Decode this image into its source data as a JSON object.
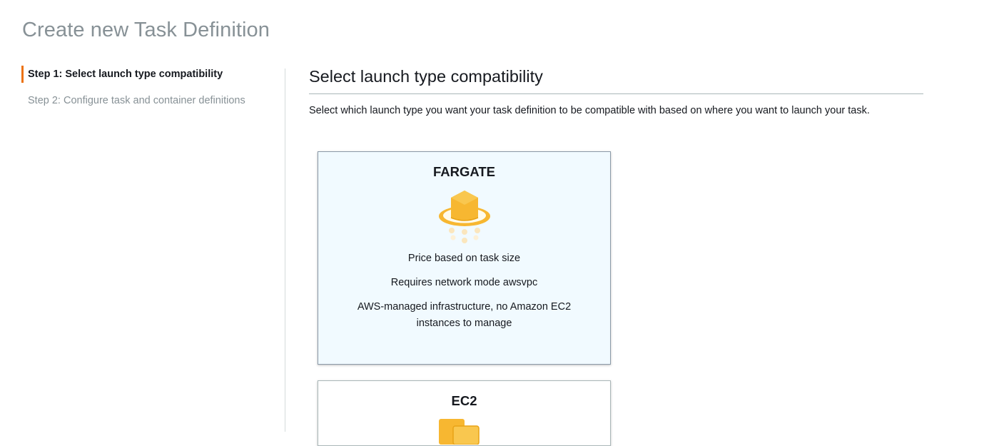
{
  "page": {
    "title": "Create new Task Definition"
  },
  "steps": [
    {
      "label": "Step 1: Select launch type compatibility",
      "active": true
    },
    {
      "label": "Step 2: Configure task and container definitions",
      "active": false
    }
  ],
  "section": {
    "title": "Select launch type compatibility",
    "description": "Select which launch type you want your task definition to be compatible with based on where you want to launch your task."
  },
  "cards": {
    "fargate": {
      "title": "FARGATE",
      "icon": "fargate-icon",
      "selected": true,
      "features": [
        "Price based on task size",
        "Requires network mode awsvpc",
        "AWS-managed infrastructure, no Amazon EC2 instances to manage"
      ]
    },
    "ec2": {
      "title": "EC2",
      "icon": "ec2-icon",
      "selected": false
    }
  },
  "colors": {
    "accent": "#ec7211",
    "icon_orange": "#f7b731",
    "selected_card_bg": "#f1faff"
  }
}
